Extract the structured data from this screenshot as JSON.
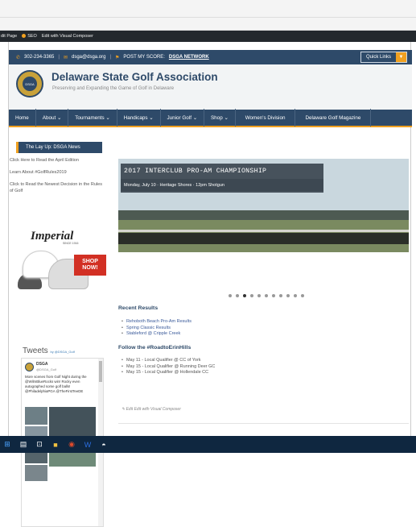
{
  "admin_bar": {
    "items": [
      "dit Page",
      "SEO",
      "Edit with Visual Composer"
    ]
  },
  "contact_bar": {
    "phone": "302-234-3365",
    "email": "dsga@dsga.org",
    "score_prefix": "POST MY SCORE:",
    "score_link": "DSGA NETWORK",
    "quick_links": "Quick Links"
  },
  "header": {
    "title": "Delaware State Golf Association",
    "tagline": "Preserving and Expanding the Game of Golf in Delaware",
    "logo_text": "DSGA"
  },
  "nav": {
    "items": [
      "Home",
      "About ⌄",
      "Tournaments ⌄",
      "Handicaps ⌄",
      "Junior Golf ⌄",
      "Shop ⌄",
      "Women's Division",
      "Delaware Golf Magazine"
    ]
  },
  "sidebar": {
    "box_title": "The Lay Up: DSGA News",
    "links": [
      "Click Here to Read the April Edition",
      "Learn About #GolfRules2019",
      "Click to Read the Newest Decision in the Rules of Golf"
    ]
  },
  "ad": {
    "brand": "Imperial",
    "since": "SINCE 1916",
    "cta_line1": "SHOP",
    "cta_line2": "NOW!"
  },
  "tweets": {
    "heading": "Tweets",
    "by": "by @DSGA_Golf",
    "name": "DSGA",
    "handle": "@DSGA_Golf",
    "text": "More scenes from Golf Night during the @WilmBlueRocks win! Rocky even autographed some golf balls! @PhiladelphiaPGA @TheFirstTeeDE"
  },
  "slider": {
    "title": "2017 INTERCLUB PRO-AM CHAMPIONSHIP",
    "subtitle": "Monday, July 10  ·  Heritage Shores  ·  12pm Shotgun",
    "dots": 11,
    "active_dot": 2
  },
  "recent_results": {
    "heading": "Recent Results",
    "items": [
      "Rehoboth Beach Pro-Am Results",
      "Spring Classic Results",
      "Stableford @ Cripple Creek"
    ]
  },
  "follow": {
    "heading": "Follow the #RoadtoErinHills",
    "items": [
      "May 11 - Local Qualifier @ CC of York",
      "May 15 - Local Qualifier @ Running Deer GC",
      "May 15 - Local Qualifier @ Hollendale CC"
    ]
  },
  "edit_vc": "Edit Edit with Visual Composer",
  "colors": {
    "navy": "#2e4a69",
    "gold": "#f0a020"
  }
}
